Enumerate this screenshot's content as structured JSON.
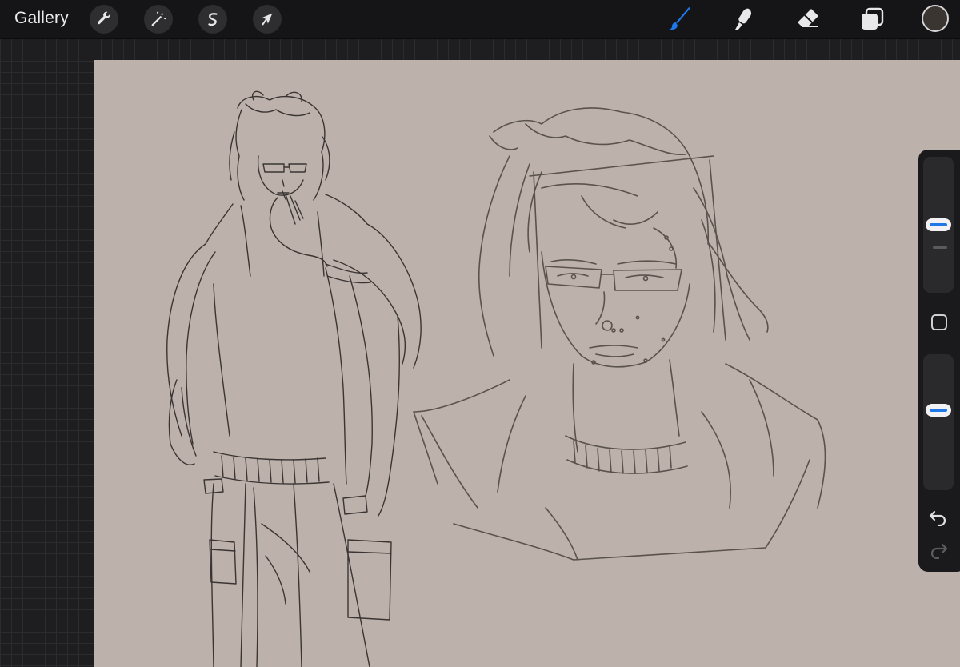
{
  "app": {
    "gallery_label": "Gallery"
  },
  "toolbar": {
    "left_tools": [
      "wrench-icon",
      "magic-wand-icon",
      "selection-icon",
      "transform-arrow-icon"
    ],
    "right_tools": [
      "brush-icon",
      "smudge-icon",
      "eraser-icon",
      "layers-icon"
    ],
    "active_tool": "brush-icon",
    "accent_color": "#1e78e8",
    "current_color": "#3b3531"
  },
  "canvas": {
    "background_color": "#bcb1ab",
    "stroke_color": "#3a3532"
  },
  "sidebar": {
    "brush_size_level": 0.5,
    "opacity_level": 0.6,
    "undo_icon": "undo-icon",
    "redo_icon": "redo-icon"
  }
}
